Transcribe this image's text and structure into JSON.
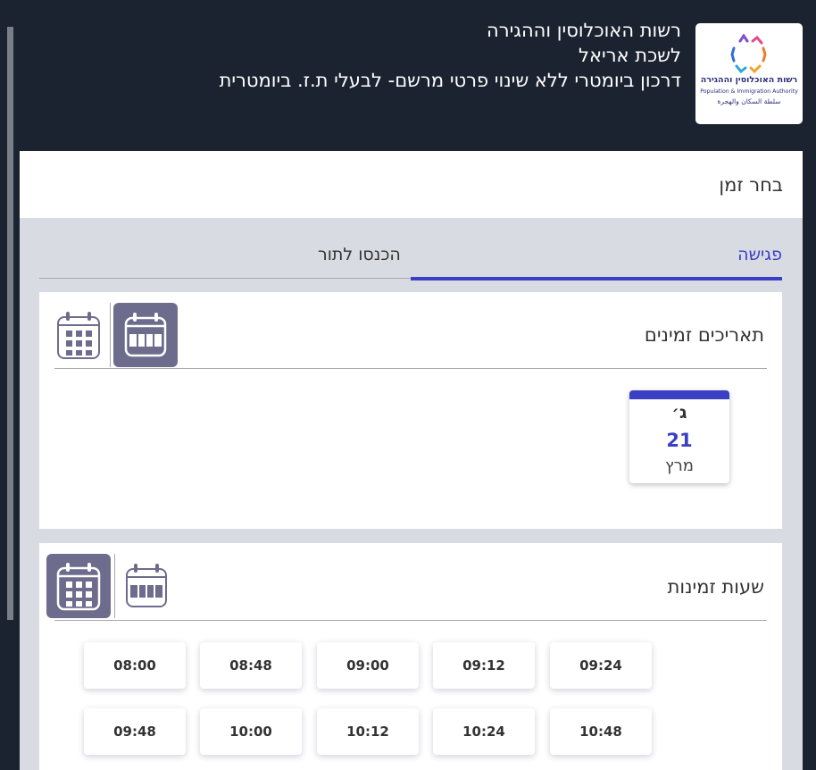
{
  "header": {
    "title_line1": "רשות האוכלוסין וההגירה",
    "title_line2": "לשכת אריאל",
    "title_line3": "דרכון ביומטרי ללא שינוי פרטי מרשם- לבעלי ת.ז. ביומטרית",
    "logo": {
      "text_he": "רשות האוכלוסין וההגירה",
      "text_en": "Population & Immigration Authority",
      "text_ar": "سلطة السكان والهجرة"
    }
  },
  "page": {
    "choose_time_title": "בחר זמן"
  },
  "tabs": [
    {
      "label": "פגישה",
      "active": true
    },
    {
      "label": "הכנסו לתור",
      "active": false
    }
  ],
  "dates_card": {
    "title": "תאריכים זמינים",
    "view_icons": [
      "calendar-week-icon",
      "calendar-grid-icon"
    ],
    "dates": [
      {
        "day": "ג׳",
        "number": "21",
        "month": "מרץ"
      }
    ]
  },
  "hours_card": {
    "title": "שעות זמינות",
    "view_icons": [
      "calendar-grid-icon",
      "calendar-week-icon"
    ],
    "slots": [
      "09:24",
      "09:12",
      "09:00",
      "08:48",
      "08:00",
      "10:48",
      "10:24",
      "10:12",
      "10:00",
      "09:48"
    ]
  },
  "colors": {
    "header_bg": "#1b2330",
    "accent": "#3a3fc4",
    "active_view_button": "#6d6c8d",
    "content_bg": "#d9dbe2"
  }
}
